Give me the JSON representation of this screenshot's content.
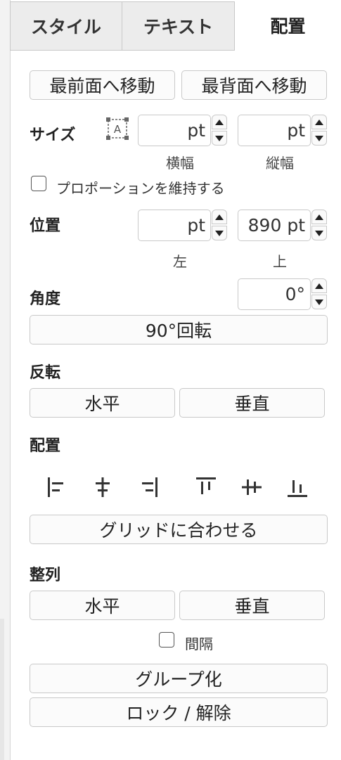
{
  "tabs": [
    {
      "label": "スタイル"
    },
    {
      "label": "テキスト"
    },
    {
      "label": "配置"
    }
  ],
  "order": {
    "to_front": "最前面へ移動",
    "to_back": "最背面へ移動"
  },
  "size": {
    "label": "サイズ",
    "width_value": "pt",
    "height_value": "pt",
    "width_caption": "横幅",
    "height_caption": "縦幅",
    "keep_proportions": "プロポーションを維持する"
  },
  "position": {
    "label": "位置",
    "left_value": "pt",
    "top_value": "890 pt",
    "left_caption": "左",
    "top_caption": "上"
  },
  "angle": {
    "label": "角度",
    "value": "0°",
    "rotate_button": "90°回転"
  },
  "flip": {
    "label": "反転",
    "horizontal": "水平",
    "vertical": "垂直"
  },
  "align": {
    "label": "配置",
    "icons": [
      "align-left-icon",
      "align-center-icon",
      "align-right-icon",
      "align-top-icon",
      "align-middle-icon",
      "align-bottom-icon"
    ],
    "snap_to_grid": "グリッドに合わせる"
  },
  "distribute": {
    "label": "整列",
    "horizontal": "水平",
    "vertical": "垂直",
    "spacing": "間隔"
  },
  "actions": {
    "group": "グループ化",
    "lock_unlock": "ロック / 解除"
  }
}
